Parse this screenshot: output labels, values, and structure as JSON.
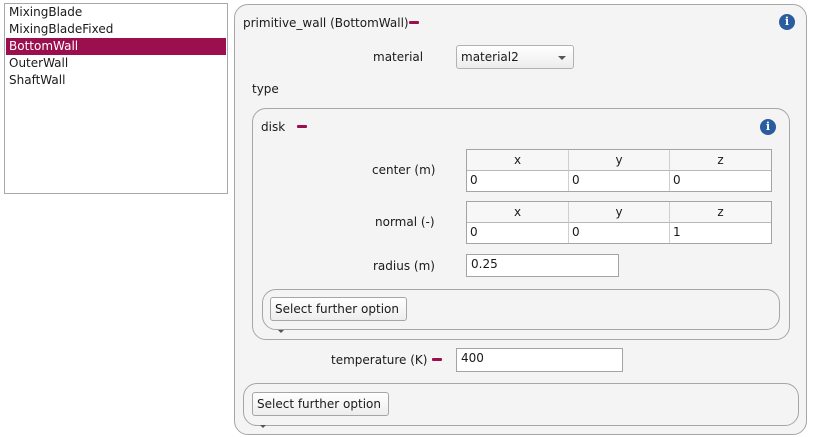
{
  "boundary_list": {
    "items": [
      {
        "label": "MixingBlade"
      },
      {
        "label": "MixingBladeFixed"
      },
      {
        "label": "BottomWall"
      },
      {
        "label": "OuterWall"
      },
      {
        "label": "ShaftWall"
      }
    ],
    "selected_index": 2
  },
  "panel": {
    "title": "primitive_wall (BottomWall)",
    "material_label": "material",
    "material_value": "material2",
    "type_label": "type",
    "disk": {
      "title": "disk",
      "center": {
        "label": "center (m)",
        "headers": [
          "x",
          "y",
          "z"
        ],
        "values": [
          "0",
          "0",
          "0"
        ]
      },
      "normal": {
        "label": "normal (-)",
        "headers": [
          "x",
          "y",
          "z"
        ],
        "values": [
          "0",
          "0",
          "1"
        ]
      },
      "radius": {
        "label": "radius (m)",
        "value": "0.25"
      },
      "further_option_label": "Select further option"
    },
    "temperature": {
      "label": "temperature (K)",
      "value": "400"
    },
    "further_option_label": "Select further option"
  },
  "icons": {
    "info": "info-icon",
    "remove": "minus-icon",
    "dropdown": "chevron-down-icon"
  },
  "colors": {
    "accent": "#9c0f4e",
    "info": "#2a5d9f"
  }
}
